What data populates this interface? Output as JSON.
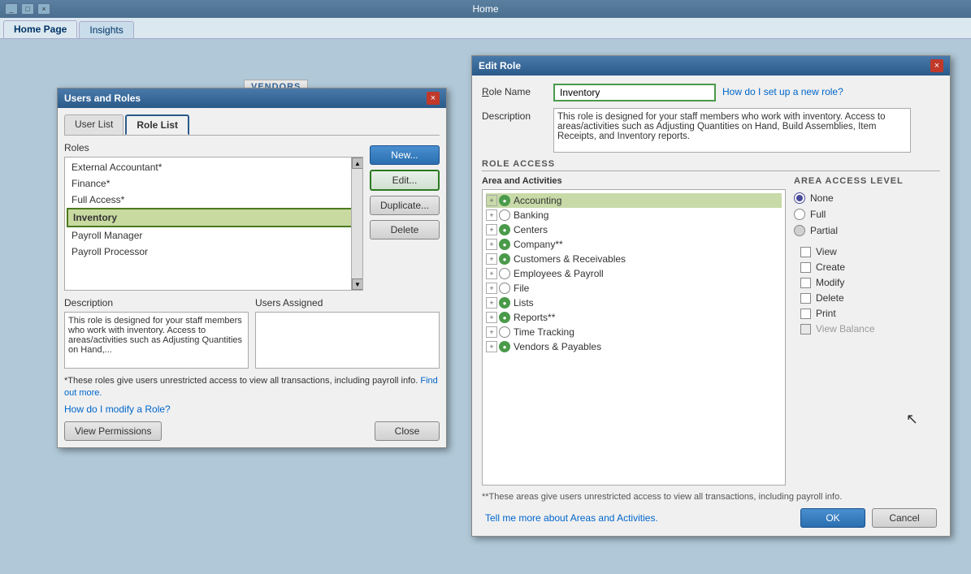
{
  "window": {
    "title": "Home",
    "close_btn": "×"
  },
  "tabs": [
    {
      "label": "Home Page",
      "active": true
    },
    {
      "label": "Insights",
      "active": false
    }
  ],
  "vendors_banner": "VENDORS",
  "users_roles_dialog": {
    "title": "Users and Roles",
    "close_btn": "×",
    "tabs": [
      {
        "label": "User List",
        "active": false
      },
      {
        "label": "Role List",
        "active": true
      }
    ],
    "roles_label": "Roles",
    "roles": [
      {
        "label": "External Accountant*",
        "selected": false
      },
      {
        "label": "Finance*",
        "selected": false
      },
      {
        "label": "Full Access*",
        "selected": false
      },
      {
        "label": "Inventory",
        "selected": true
      },
      {
        "label": "Payroll Manager",
        "selected": false
      },
      {
        "label": "Payroll Processor",
        "selected": false
      }
    ],
    "buttons": {
      "new": "New...",
      "edit": "Edit...",
      "duplicate": "Duplicate...",
      "delete": "Delete"
    },
    "description_label": "Description",
    "users_assigned_label": "Users Assigned",
    "description_text": "This role is designed for your staff members who work with inventory. Access to areas/activities such as Adjusting Quantities on Hand,...",
    "footer_note": "*These roles give users unrestricted access to view all transactions, including payroll info.",
    "find_out_link": "Find out more.",
    "modify_link": "How do I modify a Role?",
    "view_permissions_btn": "View Permissions",
    "close_btn_footer": "Close"
  },
  "edit_role_dialog": {
    "title": "Edit Role",
    "close_btn": "×",
    "role_name_label": "Role Name",
    "role_name_value": "Inventory",
    "help_link": "How do I set up a new role?",
    "description_label": "Description",
    "description_text": "This role is designed for your staff members who work with inventory. Access to areas/activities such as Adjusting Quantities on Hand, Build Assemblies, Item Receipts, and Inventory reports.",
    "role_access_header": "ROLE ACCESS",
    "area_activities_label": "Area and Activities",
    "area_access_level_header": "AREA ACCESS LEVEL",
    "tree_items": [
      {
        "label": "Accounting",
        "icon": "green",
        "expand": true,
        "selected": true
      },
      {
        "label": "Banking",
        "icon": "empty",
        "expand": false
      },
      {
        "label": "Centers",
        "icon": "green",
        "expand": false
      },
      {
        "label": "Company**",
        "icon": "green",
        "expand": false
      },
      {
        "label": "Customers & Receivables",
        "icon": "green",
        "expand": false
      },
      {
        "label": "Employees & Payroll",
        "icon": "empty",
        "expand": false
      },
      {
        "label": "File",
        "icon": "empty",
        "expand": false
      },
      {
        "label": "Lists",
        "icon": "green",
        "expand": false
      },
      {
        "label": "Reports**",
        "icon": "green",
        "expand": false
      },
      {
        "label": "Time Tracking",
        "icon": "empty",
        "expand": false
      },
      {
        "label": "Vendors & Payables",
        "icon": "green",
        "expand": false
      }
    ],
    "access_levels": [
      {
        "label": "None",
        "checked": true
      },
      {
        "label": "Full",
        "checked": false
      },
      {
        "label": "Partial",
        "checked": false
      }
    ],
    "permissions": [
      {
        "label": "View",
        "checked": false,
        "disabled": false
      },
      {
        "label": "Create",
        "checked": false,
        "disabled": false
      },
      {
        "label": "Modify",
        "checked": false,
        "disabled": false
      },
      {
        "label": "Delete",
        "checked": false,
        "disabled": false
      },
      {
        "label": "Print",
        "checked": false,
        "disabled": false
      },
      {
        "label": "View Balance",
        "checked": false,
        "disabled": true
      }
    ],
    "footer_note": "**These areas give users unrestricted access to view all transactions, including payroll info.",
    "tell_me_link": "Tell me more about Areas and Activities.",
    "ok_btn": "OK",
    "cancel_btn": "Cancel"
  }
}
